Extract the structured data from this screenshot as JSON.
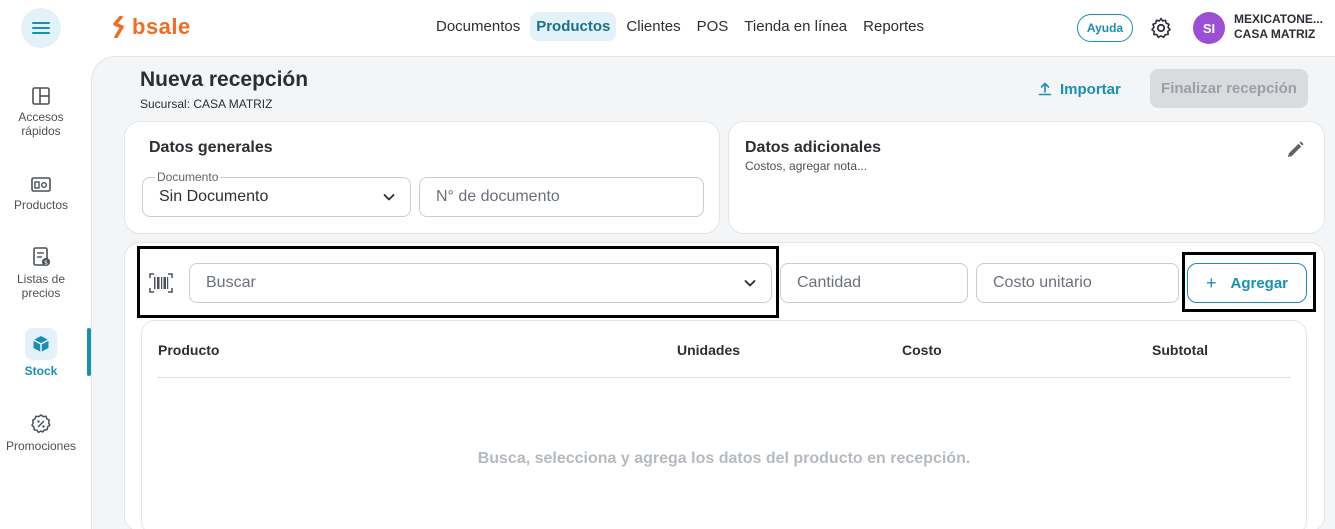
{
  "brand": {
    "name": "bsale",
    "color": "#f26b22"
  },
  "nav": {
    "items": [
      {
        "label": "Documentos"
      },
      {
        "label": "Productos"
      },
      {
        "label": "Clientes"
      },
      {
        "label": "POS"
      },
      {
        "label": "Tienda en línea"
      },
      {
        "label": "Reportes"
      }
    ],
    "active": "Productos"
  },
  "header": {
    "help_label": "Ayuda",
    "avatar_initials": "SI",
    "account_name": "MEXICATONE...",
    "account_branch": "CASA MATRIZ"
  },
  "sidebar": {
    "items": [
      {
        "line1": "Accesos",
        "line2": "rápidos",
        "icon": "layout-icon"
      },
      {
        "line1": "Productos",
        "line2": "",
        "icon": "products-icon"
      },
      {
        "line1": "Listas de",
        "line2": "precios",
        "icon": "price-list-icon"
      },
      {
        "line1": "Stock",
        "line2": "",
        "icon": "box-icon"
      },
      {
        "line1": "Promociones",
        "line2": "",
        "icon": "discount-icon"
      }
    ],
    "active": "Stock"
  },
  "page": {
    "title": "Nueva recepción",
    "subtitle": "Sucursal: CASA MATRIZ",
    "import_label": "Importar",
    "finalize_label": "Finalizar recepción"
  },
  "general": {
    "title": "Datos generales",
    "document_label": "Documento",
    "document_value": "Sin Documento",
    "doc_number_placeholder": "N° de documento"
  },
  "additional": {
    "title": "Datos adicionales",
    "subtitle": "Costos, agregar nota..."
  },
  "entry": {
    "search_placeholder": "Buscar",
    "quantity_placeholder": "Cantidad",
    "unit_cost_placeholder": "Costo unitario",
    "add_label": "Agregar"
  },
  "table": {
    "columns": [
      "Producto",
      "Unidades",
      "Costo",
      "Subtotal"
    ],
    "empty_message": "Busca, selecciona y agrega los datos del producto en recepción."
  },
  "colors": {
    "accent": "#1a8fb5",
    "avatar": "#9a4fd6",
    "active_bg": "#e3f1f8"
  }
}
